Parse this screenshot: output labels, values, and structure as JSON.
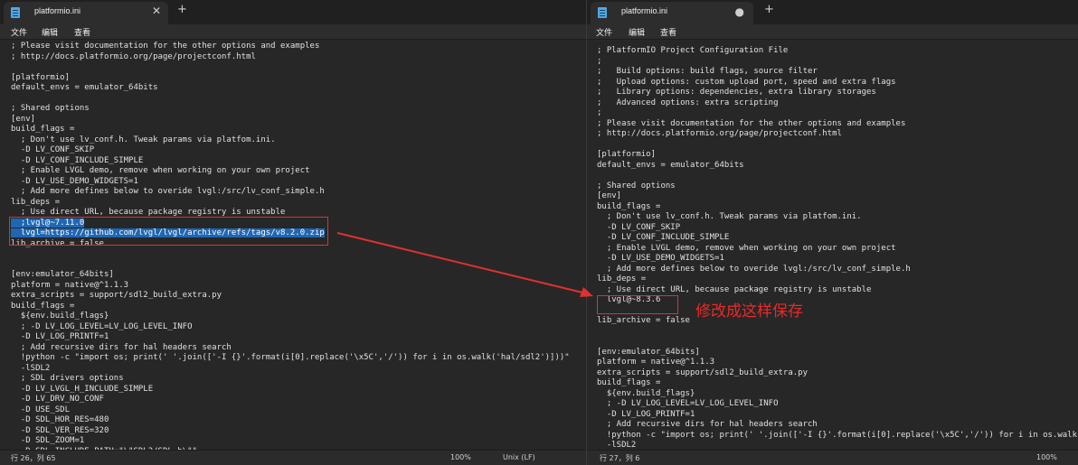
{
  "left": {
    "tab_title": "platformio.ini",
    "close_glyph": "✕",
    "add_glyph": "+",
    "menu": [
      "文件",
      "编辑",
      "查看"
    ],
    "lines": [
      "; Please visit documentation for the other options and examples",
      "; http://docs.platformio.org/page/projectconf.html",
      "",
      "[platformio]",
      "default_envs = emulator_64bits",
      "",
      "; Shared options",
      "[env]",
      "build_flags =",
      "  ; Don't use lv_conf.h. Tweak params via platfom.ini.",
      "  -D LV_CONF_SKIP",
      "  -D LV_CONF_INCLUDE_SIMPLE",
      "  ; Enable LVGL demo, remove when working on your own project",
      "  -D LV_USE_DEMO_WIDGETS=1",
      "  ; Add more defines below to overide lvgl:/src/lv_conf_simple.h",
      "lib_deps =",
      "  ; Use direct URL, because package registry is unstable",
      "  ;lvgl@~7.11.0",
      "  lvgl=https://github.com/lvgl/lvgl/archive/refs/tags/v8.2.0.zip",
      "lib_archive = false",
      "",
      "",
      "[env:emulator_64bits]",
      "platform = native@^1.1.3",
      "extra_scripts = support/sdl2_build_extra.py",
      "build_flags =",
      "  ${env.build_flags}",
      "  ; -D LV_LOG_LEVEL=LV_LOG_LEVEL_INFO",
      "  -D LV_LOG_PRINTF=1",
      "  ; Add recursive dirs for hal headers search",
      "  !python -c \"import os; print(' '.join(['-I {}'.format(i[0].replace('\\x5C','/')) for i in os.walk('hal/sdl2')]))\"",
      "  -lSDL2",
      "  ; SDL drivers options",
      "  -D LV_LVGL_H_INCLUDE_SIMPLE",
      "  -D LV_DRV_NO_CONF",
      "  -D USE_SDL",
      "  -D SDL_HOR_RES=480",
      "  -D SDL_VER_RES=320",
      "  -D SDL_ZOOM=1",
      "  -D SDL_INCLUDE_PATH=\"\\\"SDL2/SDL.h\\\"\""
    ],
    "selected_lines": [
      17,
      18
    ],
    "status": {
      "position": "行 26，列 65",
      "zoom": "100%",
      "line_ending": "Unix (LF)"
    }
  },
  "right": {
    "tab_title": "platformio.ini",
    "modified_glyph": "●",
    "add_glyph": "+",
    "menu": [
      "文件",
      "编辑",
      "查看"
    ],
    "lines": [
      "; PlatformIO Project Configuration File",
      ";",
      ";   Build options: build flags, source filter",
      ";   Upload options: custom upload port, speed and extra flags",
      ";   Library options: dependencies, extra library storages",
      ";   Advanced options: extra scripting",
      ";",
      "; Please visit documentation for the other options and examples",
      "; http://docs.platformio.org/page/projectconf.html",
      "",
      "[platformio]",
      "default_envs = emulator_64bits",
      "",
      "; Shared options",
      "[env]",
      "build_flags =",
      "  ; Don't use lv_conf.h. Tweak params via platfom.ini.",
      "  -D LV_CONF_SKIP",
      "  -D LV_CONF_INCLUDE_SIMPLE",
      "  ; Enable LVGL demo, remove when working on your own project",
      "  -D LV_USE_DEMO_WIDGETS=1",
      "  ; Add more defines below to overide lvgl:/src/lv_conf_simple.h",
      "lib_deps =",
      "  ; Use direct URL, because package registry is unstable",
      "  lvgl@~8.3.6",
      "",
      "lib_archive = false",
      "",
      "",
      "[env:emulator_64bits]",
      "platform = native@^1.1.3",
      "extra_scripts = support/sdl2_build_extra.py",
      "build_flags =",
      "  ${env.build_flags}",
      "  ; -D LV_LOG_LEVEL=LV_LOG_LEVEL_INFO",
      "  -D LV_LOG_PRINTF=1",
      "  ; Add recursive dirs for hal headers search",
      "  !python -c \"import os; print(' '.join(['-I {}'.format(i[0].replace('\\x5C','/')) for i in os.walk('hal/",
      "  -lSDL2"
    ],
    "status": {
      "position": "行 27，列 6",
      "zoom": "100%",
      "line_ending": "Unix (LF)"
    }
  },
  "annotation": {
    "text": "修改成这样保存",
    "color": "#e82a2a"
  },
  "colors": {
    "selection": "#1f67b4",
    "editor_bg": "#272727",
    "accent_red": "#e03030"
  }
}
